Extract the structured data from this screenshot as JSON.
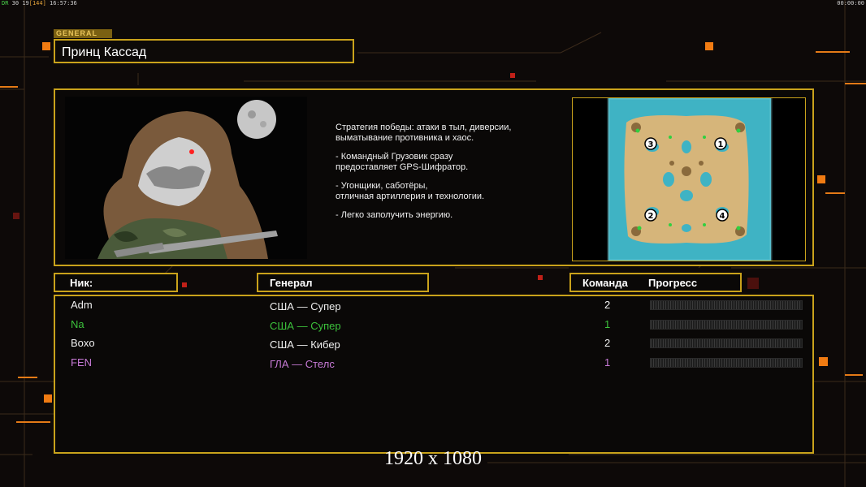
{
  "overlay": {
    "fps_label": "DR",
    "fps_a": "30",
    "fps_b": "19",
    "fps_c": "[144]",
    "clock_left": "16:57:36",
    "clock_right": "00:00:00"
  },
  "general": {
    "tag": "GENERAL",
    "name": "Принц Кассад",
    "description": [
      "Стратегия победы: атаки в тыл, диверсии,\n выматывание противника и хаос.",
      "- Командный Грузовик сразу\nпредоставляет GPS-Шифратор.",
      "- Угонщики, саботёры,\nотличная артиллерия и технологии.",
      "- Легко заполучить энергию."
    ]
  },
  "minimap": {
    "spawns": [
      "1",
      "2",
      "3",
      "4"
    ]
  },
  "table": {
    "headers": {
      "nick": "Ник:",
      "general": "Генерал",
      "team": "Команда",
      "progress": "Прогресс"
    },
    "players": [
      {
        "nick": "Adm",
        "general": "США — Супер",
        "team": "2",
        "progress": 0,
        "color": "#f0f0f0"
      },
      {
        "nick": "Na",
        "general": "США — Супер",
        "team": "1",
        "progress": 0,
        "color": "#3cc23c"
      },
      {
        "nick": "Boxo",
        "general": "США — Кибер",
        "team": "2",
        "progress": 0,
        "color": "#f0f0f0"
      },
      {
        "nick": "FEN",
        "general": "ГЛА — Стелс",
        "team": "1",
        "progress": 0,
        "color": "#c77ad6"
      }
    ]
  },
  "footer": {
    "resolution": "1920 x 1080"
  },
  "colors": {
    "accent_gold": "#c9a21b",
    "accent_orange": "#f07b12",
    "background": "#0d0908"
  }
}
